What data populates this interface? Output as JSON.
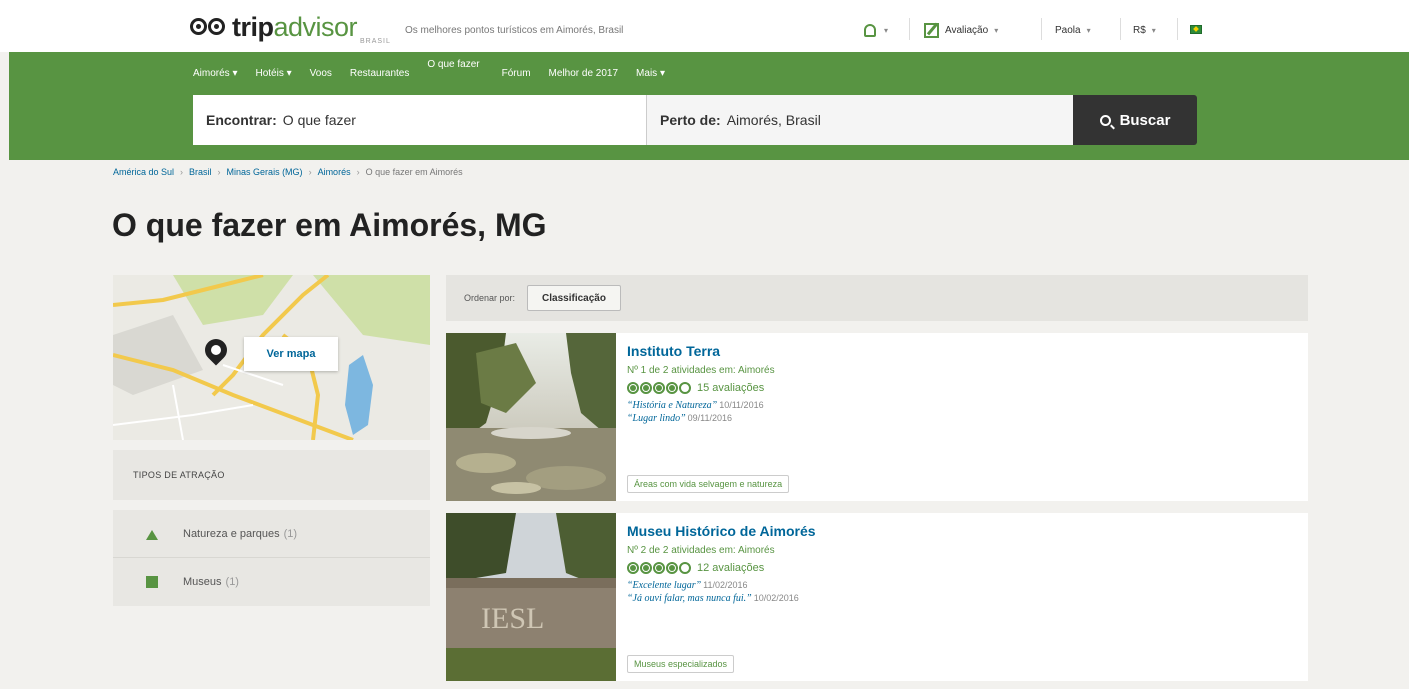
{
  "header": {
    "logo_main": "trip",
    "logo_accent": "advisor",
    "logo_sub": "BRASIL",
    "tagline": "Os melhores pontos turísticos em Aimorés, Brasil",
    "notifications_caret": "▾",
    "review_label": "Avaliação",
    "user_label": "Paola",
    "currency_label": "R$"
  },
  "nav": {
    "items": [
      "Aimorés ▾",
      "Hotéis ▾",
      "Voos",
      "Restaurantes",
      "O que fazer",
      "Fórum",
      "Melhor de 2017",
      "Mais ▾"
    ]
  },
  "search": {
    "find_label": "Encontrar:",
    "find_value": "O que fazer",
    "near_label": "Perto de:",
    "near_value": "Aimorés, Brasil",
    "button_label": "Buscar"
  },
  "breadcrumb": [
    "América do Sul",
    "Brasil",
    "Minas Gerais (MG)",
    "Aimorés",
    "O que fazer em Aimorés"
  ],
  "page_title": "O que fazer em Aimorés, MG",
  "sidebar": {
    "map_button": "Ver mapa",
    "types_heading": "TIPOS DE ATRAÇÃO",
    "types": [
      {
        "label": "Natureza e parques",
        "count": "(1)",
        "icon": "tree-icon"
      },
      {
        "label": "Museus",
        "count": "(1)",
        "icon": "museum-icon"
      }
    ]
  },
  "sort": {
    "label": "Ordenar por:",
    "selected": "Classificação"
  },
  "listings": [
    {
      "name": "Instituto Terra",
      "rank": "Nº 1 de 2 atividades em: Aimorés",
      "rating": 4,
      "reviews": "15 avaliações",
      "quotes": [
        {
          "text": "“História e Natureza”",
          "date": "10/11/2016"
        },
        {
          "text": "“Lugar lindo”",
          "date": "09/11/2016"
        }
      ],
      "tag": "Áreas com vida selvagem e natureza"
    },
    {
      "name": "Museu Histórico de Aimorés",
      "rank": "Nº 2 de 2 atividades em: Aimorés",
      "rating": 4,
      "reviews": "12 avaliações",
      "quotes": [
        {
          "text": "“Excelente lugar”",
          "date": "11/02/2016"
        },
        {
          "text": "“Já ouvi falar, mas nunca fui.”",
          "date": "10/02/2016"
        }
      ],
      "tag": "Museus especializados"
    }
  ]
}
